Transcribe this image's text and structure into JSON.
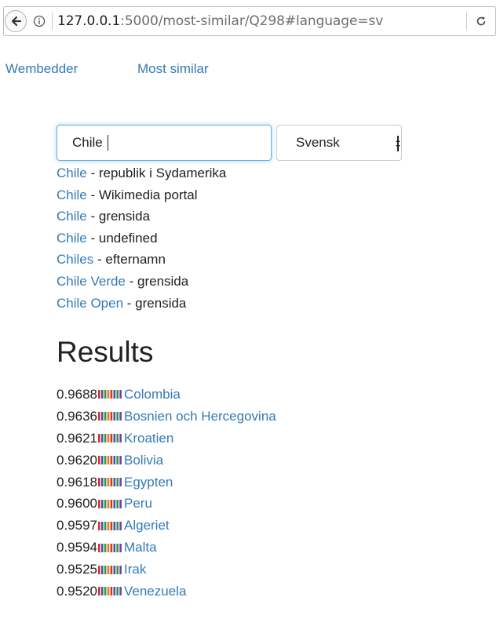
{
  "browser": {
    "url_host": "127.0.0.1",
    "url_path": ":5000/most-similar/Q298#language=sv"
  },
  "nav": {
    "brand": "Wembedder",
    "most_similar": "Most similar"
  },
  "search": {
    "value": "Chile",
    "language": "Svensk"
  },
  "suggestions": [
    {
      "label": "Chile",
      "description": "republik i Sydamerika"
    },
    {
      "label": "Chile",
      "description": "Wikimedia portal"
    },
    {
      "label": "Chile",
      "description": "grensida"
    },
    {
      "label": "Chile",
      "description": "undefined"
    },
    {
      "label": "Chiles",
      "description": "efternamn"
    },
    {
      "label": "Chile Verde",
      "description": "grensida"
    },
    {
      "label": "Chile Open",
      "description": "grensida"
    }
  ],
  "suggestion_separator": " - ",
  "results": {
    "heading": "Results",
    "items": [
      {
        "score": "0.9688",
        "name": "Colombia"
      },
      {
        "score": "0.9636",
        "name": "Bosnien och Hercegovina"
      },
      {
        "score": "0.9621",
        "name": "Kroatien"
      },
      {
        "score": "0.9620",
        "name": "Bolivia"
      },
      {
        "score": "0.9618",
        "name": "Egypten"
      },
      {
        "score": "0.9600",
        "name": "Peru"
      },
      {
        "score": "0.9597",
        "name": "Algeriet"
      },
      {
        "score": "0.9594",
        "name": "Malta"
      },
      {
        "score": "0.9525",
        "name": "Irak"
      },
      {
        "score": "0.9520",
        "name": "Venezuela"
      }
    ]
  },
  "colors": {
    "link": "#337ab7",
    "bar_stripes": [
      "#d9302a",
      "#3a5aa8",
      "#2f9b3e",
      "#e07f1f",
      "#d9302a",
      "#3a5aa8",
      "#2f9b3e",
      "#7a3aa8"
    ]
  },
  "icons": {
    "back": "back-arrow-icon",
    "info": "info-icon",
    "reload": "reload-icon",
    "score_bar": "score-bar-icon"
  }
}
